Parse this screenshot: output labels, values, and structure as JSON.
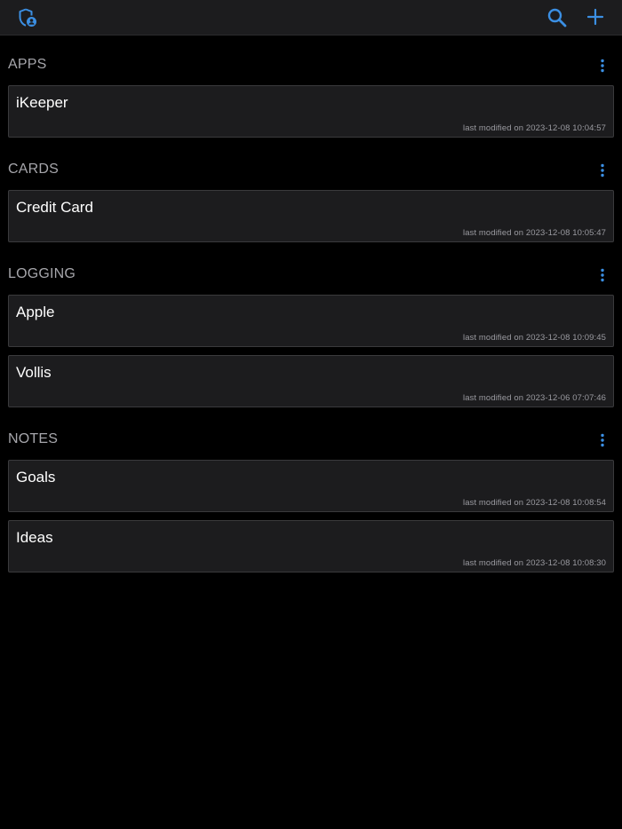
{
  "toolbar": {
    "app_icon": "shield-person-icon",
    "search_icon": "search-icon",
    "add_icon": "plus-icon",
    "accent_color": "#3b8fe3"
  },
  "sections": [
    {
      "title": "APPS",
      "menu_icon": "more-vertical-icon",
      "items": [
        {
          "title": "iKeeper",
          "meta": "last modified on 2023-12-08 10:04:57"
        }
      ]
    },
    {
      "title": "CARDS",
      "menu_icon": "more-vertical-icon",
      "items": [
        {
          "title": "Credit Card",
          "meta": "last modified on 2023-12-08 10:05:47"
        }
      ]
    },
    {
      "title": "LOGGING",
      "menu_icon": "more-vertical-icon",
      "items": [
        {
          "title": "Apple",
          "meta": "last modified on 2023-12-08 10:09:45"
        },
        {
          "title": "Vollis",
          "meta": "last modified on 2023-12-06 07:07:46"
        }
      ]
    },
    {
      "title": "NOTES",
      "menu_icon": "more-vertical-icon",
      "items": [
        {
          "title": "Goals",
          "meta": "last modified on 2023-12-08 10:08:54"
        },
        {
          "title": "Ideas",
          "meta": "last modified on 2023-12-08 10:08:30"
        }
      ]
    }
  ]
}
